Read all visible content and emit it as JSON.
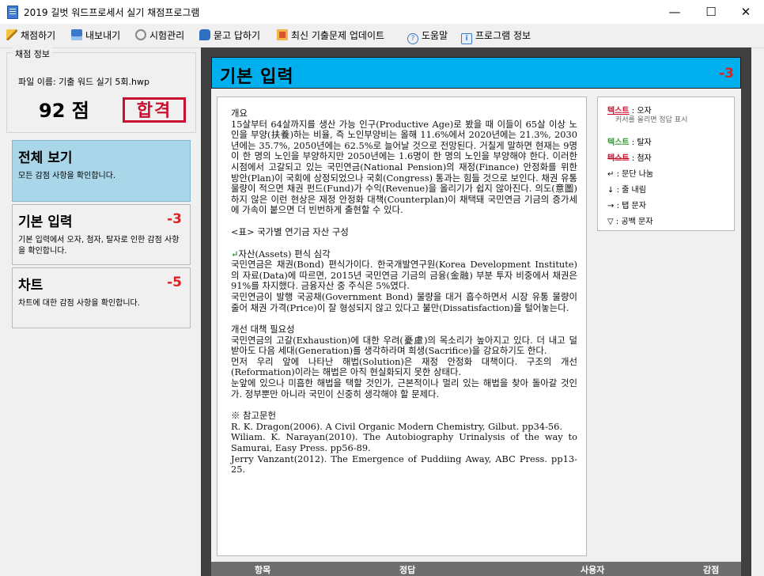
{
  "window": {
    "title": "2019 길벗 워드프로세서 실기 채점프로그램",
    "controls": {
      "minimize": "—",
      "maximize": "☐",
      "close": "✕"
    }
  },
  "toolbar": [
    {
      "label": "채점하기",
      "icon": "pencil-icon"
    },
    {
      "label": "내보내기",
      "icon": "export-icon"
    },
    {
      "label": "시험관리",
      "icon": "exam-icon"
    },
    {
      "label": "묻고 답하기",
      "icon": "qa-icon"
    },
    {
      "label": "최신 기출문제 업데이트",
      "icon": "update-icon"
    },
    {
      "label": "도움말",
      "icon": "help-icon",
      "glyph": "?"
    },
    {
      "label": "프로그램 정보",
      "icon": "info-icon",
      "glyph": "i"
    }
  ],
  "score_info": {
    "legend": "채점 정보",
    "file_name": "파일 이름: 기출 워드 실기 5회.hwp",
    "score": "92 점",
    "result": "합격"
  },
  "categories": [
    {
      "title": "전체 보기",
      "penalty": "",
      "description": "모든 감점 사항을 확인합니다.",
      "active": true
    },
    {
      "title": "기본 입력",
      "penalty": "-3",
      "description": "기본 입력에서 오자, 첨자, 탈자로 인한 감점 사항을 확인합니다.",
      "active": false
    },
    {
      "title": "차트",
      "penalty": "-5",
      "description": "차트에 대한 감점 사항을 확인합니다.",
      "active": false
    }
  ],
  "detail": {
    "title": "기본 입력",
    "penalty": "-3"
  },
  "document": {
    "lines": [
      "개요",
      "15살부터 64살까지를 생산 가능 인구(Productive Age)로 봤을 때 이들이 65살 이상 노인을 부양(扶養)하는 비율, 즉 노인부양비는 올해 11.6%에서 2020년에는 21.3%, 2030년에는 35.7%, 2050년에는 62.5%로 늘어날 것으로 전망된다. 거칠게 말하면 현재는 9명이 한 명의 노인을 부양하지만 2050년에는 1.6명이 한 명의 노인을 부양해야 한다. 이러한 시점에서 고갈되고 있는 국민연금(National Pension)의 재정(Finance) 안정화를 위한 방안(Plan)이 국회에 상정되었으나 국회(Congress) 통과는 힘들 것으로 보인다. 채권 유통 물량이 적으면 채권 펀드(Fund)가 수익(Revenue)을 올리기가 쉽지 않아진다. 의도(意圖)하지 않은 이런 현상은 재정 안정화 대책(Counterplan)이 채택돼 국민연금 기금의 증가세에 가속이 붙으면 더 빈번하게 출현할 수 있다.",
      "",
      "<표> 국가별 연기금 자산 구성",
      "",
      "↵자산(Assets) 편식 심각",
      "국민연금은 채권(Bond) 편식가이다. 한국개발연구원(Korea Development Institute)의 자료(Data)에 따르면, 2015년 국민연금 기금의 금융(金融) 부분 투자 비중에서 채권은 91%를 차지했다. 금융자산 중 주식은 5%였다.",
      "국민연금이 발행 국공채(Government Bond) 물량을 대거 흡수하면서 시장 유통 물량이 줄어 채권 가격(Price)이 잘 형성되지 않고 있다고 불만(Dissatisfaction)을 털어놓는다.",
      "",
      "개선 대책 필요성",
      "국민연금의 고갈(Exhaustion)에 대한 우려(憂慮)의 목소리가 높아지고 있다. 더 내고 덜 받아도 다음 세대(Generation)를 생각하라며 희생(Sacrifice)을 강요하기도 한다.",
      "먼저 우리 앞에 나타난 해법(Solution)은 재정 안정화 대책이다. 구조의 개선(Reformation)이라는 해법은 아직 현실화되지 못한 상태다.",
      "눈앞에 있으나 미흡한 해법을 택할 것인가, 근본적이나 멀리 있는 해법을 찾아 돌아갈 것인가. 정부뿐만 아니라 국민이 신중히 생각해야 할 문제다.",
      "",
      "※ 참고문헌",
      "R. K. Dragon(2006). A Civil Organic Modern Chemistry, Gilbut. pp34-56.",
      "Wiliam. K. Narayan(2010). The Autobiography Urinalysis of the way to Samurai, Easy Press. pp56-89.",
      "Jerry Vanzant(2012). The Emergence of Puddiing Away, ABC Press. pp13-25."
    ]
  },
  "legend": {
    "error_label": "텍스트",
    "error_desc": ": 오자",
    "tooltip_hint": "커서를 올리면 정답 표시",
    "missing_label": "텍스트",
    "missing_desc": ": 탈자",
    "extra_label": "텍스트",
    "extra_desc": ": 첨자",
    "para_symbol": "↵",
    "para_desc": ": 문단 나눔",
    "line_symbol": "↓",
    "line_desc": ": 줄 내림",
    "tab_symbol": "→",
    "tab_desc": ": 탭 문자",
    "space_symbol": "▽",
    "space_desc": ": 공백 문자"
  },
  "grid_columns": [
    "항목",
    "정답",
    "사용자",
    "감점"
  ]
}
